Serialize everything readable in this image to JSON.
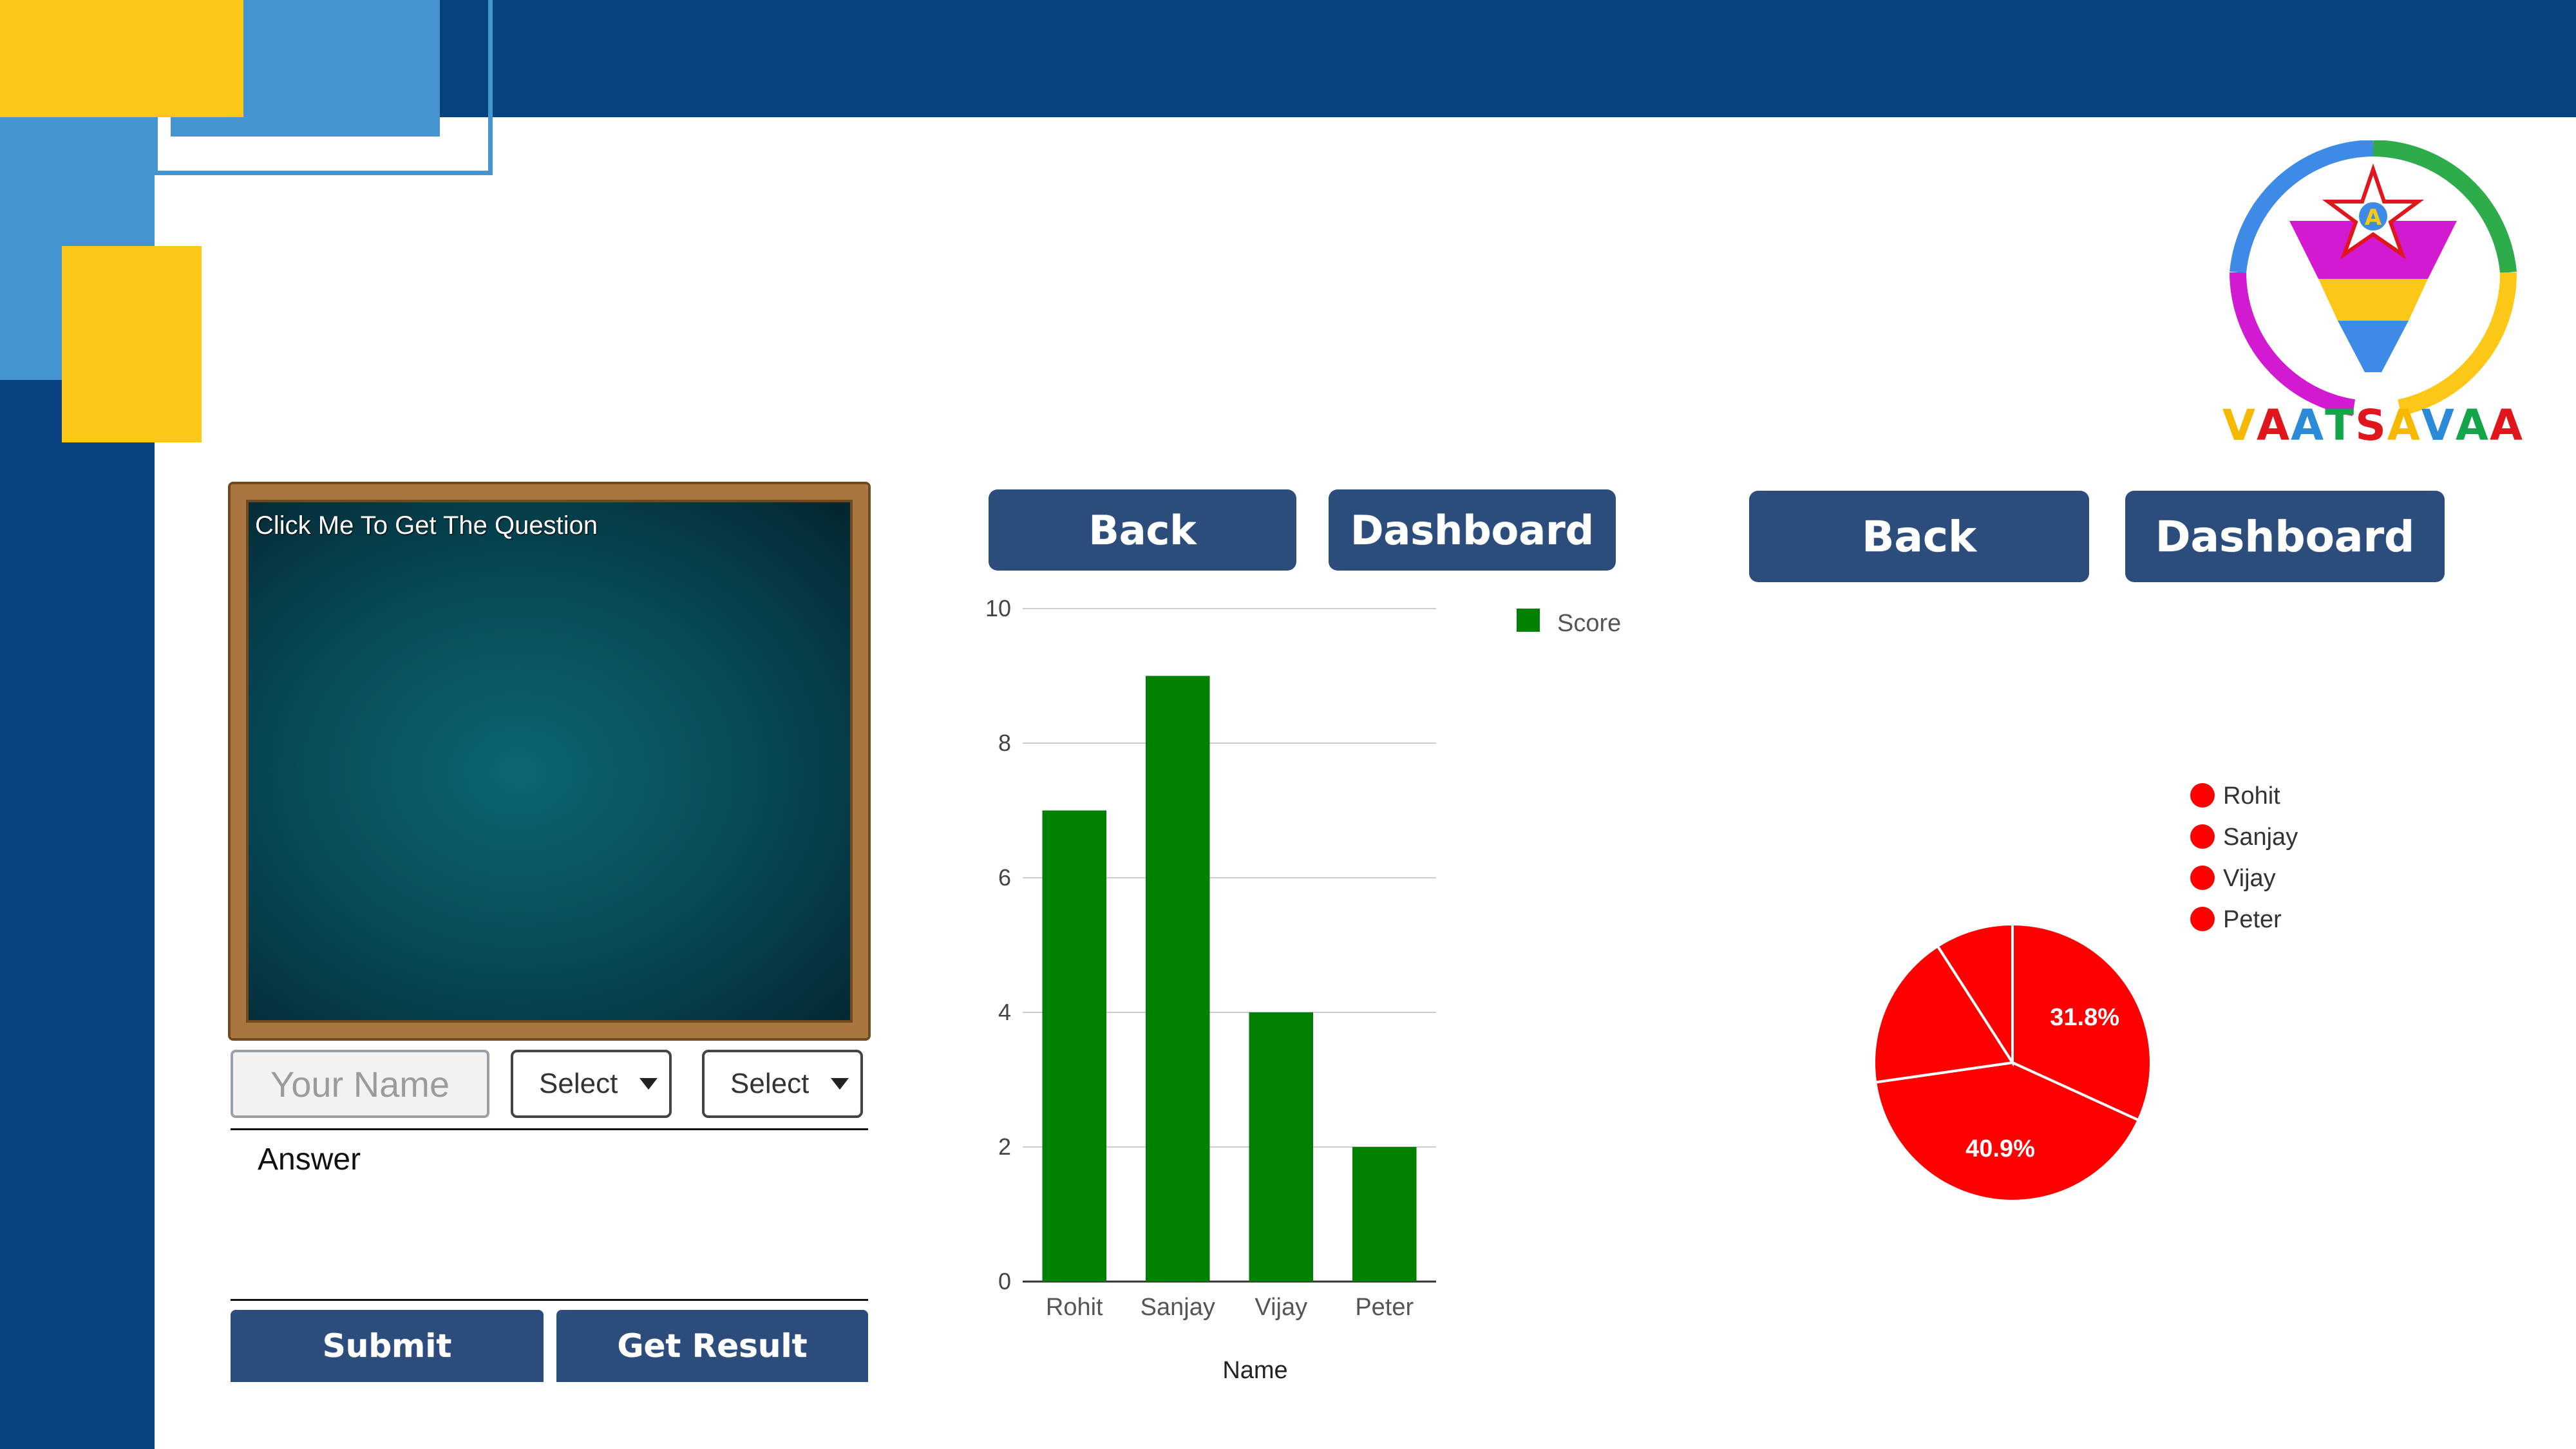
{
  "brand": {
    "logo_text": "VAATSAVAA",
    "logo_text_colors": [
      "#f7b900",
      "#e0161c",
      "#2b8bd9",
      "#14a54a",
      "#e0161c",
      "#f7b900",
      "#2b8bd9",
      "#14a54a",
      "#e0161c"
    ],
    "logo_letter_in_star": "A"
  },
  "colors": {
    "dark_blue": "#05427f",
    "light_blue": "#4494cf",
    "yellow": "#fcc717",
    "button_blue": "#2c4c7c",
    "bar_green": "#008000",
    "pie_red": "#ff0000"
  },
  "question_panel": {
    "prompt": "Click Me To Get The Question"
  },
  "form": {
    "name_placeholder": "Your Name",
    "select_1_value": "Select",
    "select_2_value": "Select",
    "answer_value": "Answer",
    "submit_label": "Submit",
    "get_result_label": "Get Result"
  },
  "nav_left": {
    "back_label": "Back",
    "dashboard_label": "Dashboard"
  },
  "nav_right": {
    "back_label": "Back",
    "dashboard_label": "Dashboard"
  },
  "chart_data": [
    {
      "type": "bar",
      "categories": [
        "Rohit",
        "Sanjay",
        "Vijay",
        "Peter"
      ],
      "series": [
        {
          "name": "Score",
          "values": [
            7,
            9,
            4,
            2
          ]
        }
      ],
      "xlabel": "Name",
      "ylabel": "",
      "ylim": [
        0,
        10
      ],
      "yticks": [
        0,
        2,
        4,
        6,
        8,
        10
      ],
      "grid": true,
      "legend_position": "top-right",
      "color": "#008000"
    },
    {
      "type": "pie",
      "labels": [
        "Rohit",
        "Sanjay",
        "Vijay",
        "Peter"
      ],
      "values": [
        7,
        9,
        4,
        2
      ],
      "shown_percent_labels": [
        "31.8%",
        "40.9%"
      ],
      "legend_position": "right",
      "color": "#ff0000"
    }
  ]
}
